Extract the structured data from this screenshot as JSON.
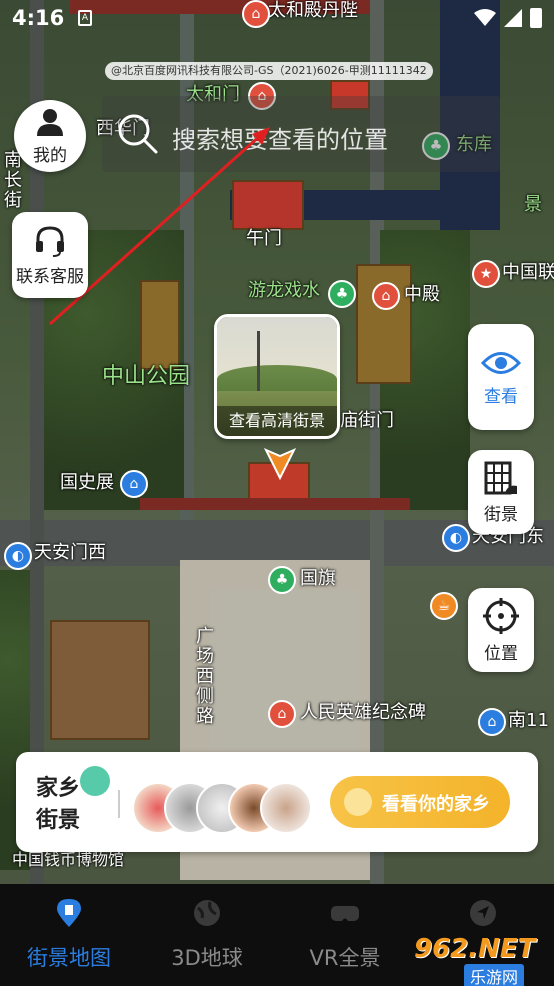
{
  "status_bar": {
    "time": "4:16",
    "sim_label": "A"
  },
  "map": {
    "copyright": "@北京百度网讯科技有限公司-GS（2021)6026-甲测11111342",
    "labels": {
      "taihedianmen": "太和殿丹陛",
      "taihemen": "太和门",
      "xihuamen": "西华门",
      "dongku": "东库",
      "wumen": "午门",
      "youlongxishui": "游龙戏水",
      "zhongdian": "中殿",
      "zhongguolian": "中国联",
      "zhongshangongyuan": "中山公园",
      "taimiaojiemen": "庙街门",
      "guoshizhan": "国史展",
      "tiananmenxi": "天安门西",
      "tiananmendong": "天安门东",
      "guoqi": "国旗",
      "guangchangxice": "广场西侧路",
      "renminyingxiong": "人民英雄纪念碑",
      "nan11": "南11",
      "guojiabowuguan": "中国钱币博物馆",
      "nanchangjie": "南长街",
      "jingyuan": "景",
      "dongfang": "东"
    }
  },
  "search": {
    "placeholder": "搜索想要查看的位置"
  },
  "buttons": {
    "me": "我的",
    "customer_service": "联系客服",
    "view": "查看",
    "street_view": "街景",
    "locate": "位置"
  },
  "street_view_card": {
    "caption": "查看高清街景"
  },
  "banner": {
    "title_line1": "家乡",
    "title_line2": "街景",
    "cta_label": "看看你的家乡"
  },
  "tabs": [
    {
      "label": "街景地图",
      "active": true,
      "icon": "map-pin-icon"
    },
    {
      "label": "3D地球",
      "active": false,
      "icon": "globe-icon"
    },
    {
      "label": "VR全景",
      "active": false,
      "icon": "vr-goggles-icon"
    },
    {
      "label": "",
      "active": false,
      "icon": "compass-icon"
    }
  ],
  "watermark": {
    "number": "962.NET",
    "sub": "乐游网"
  },
  "colors": {
    "accent": "#2b7de0",
    "cta": "#f4b32a",
    "poi_red": "#e0503c",
    "poi_green": "#2fae5f"
  }
}
